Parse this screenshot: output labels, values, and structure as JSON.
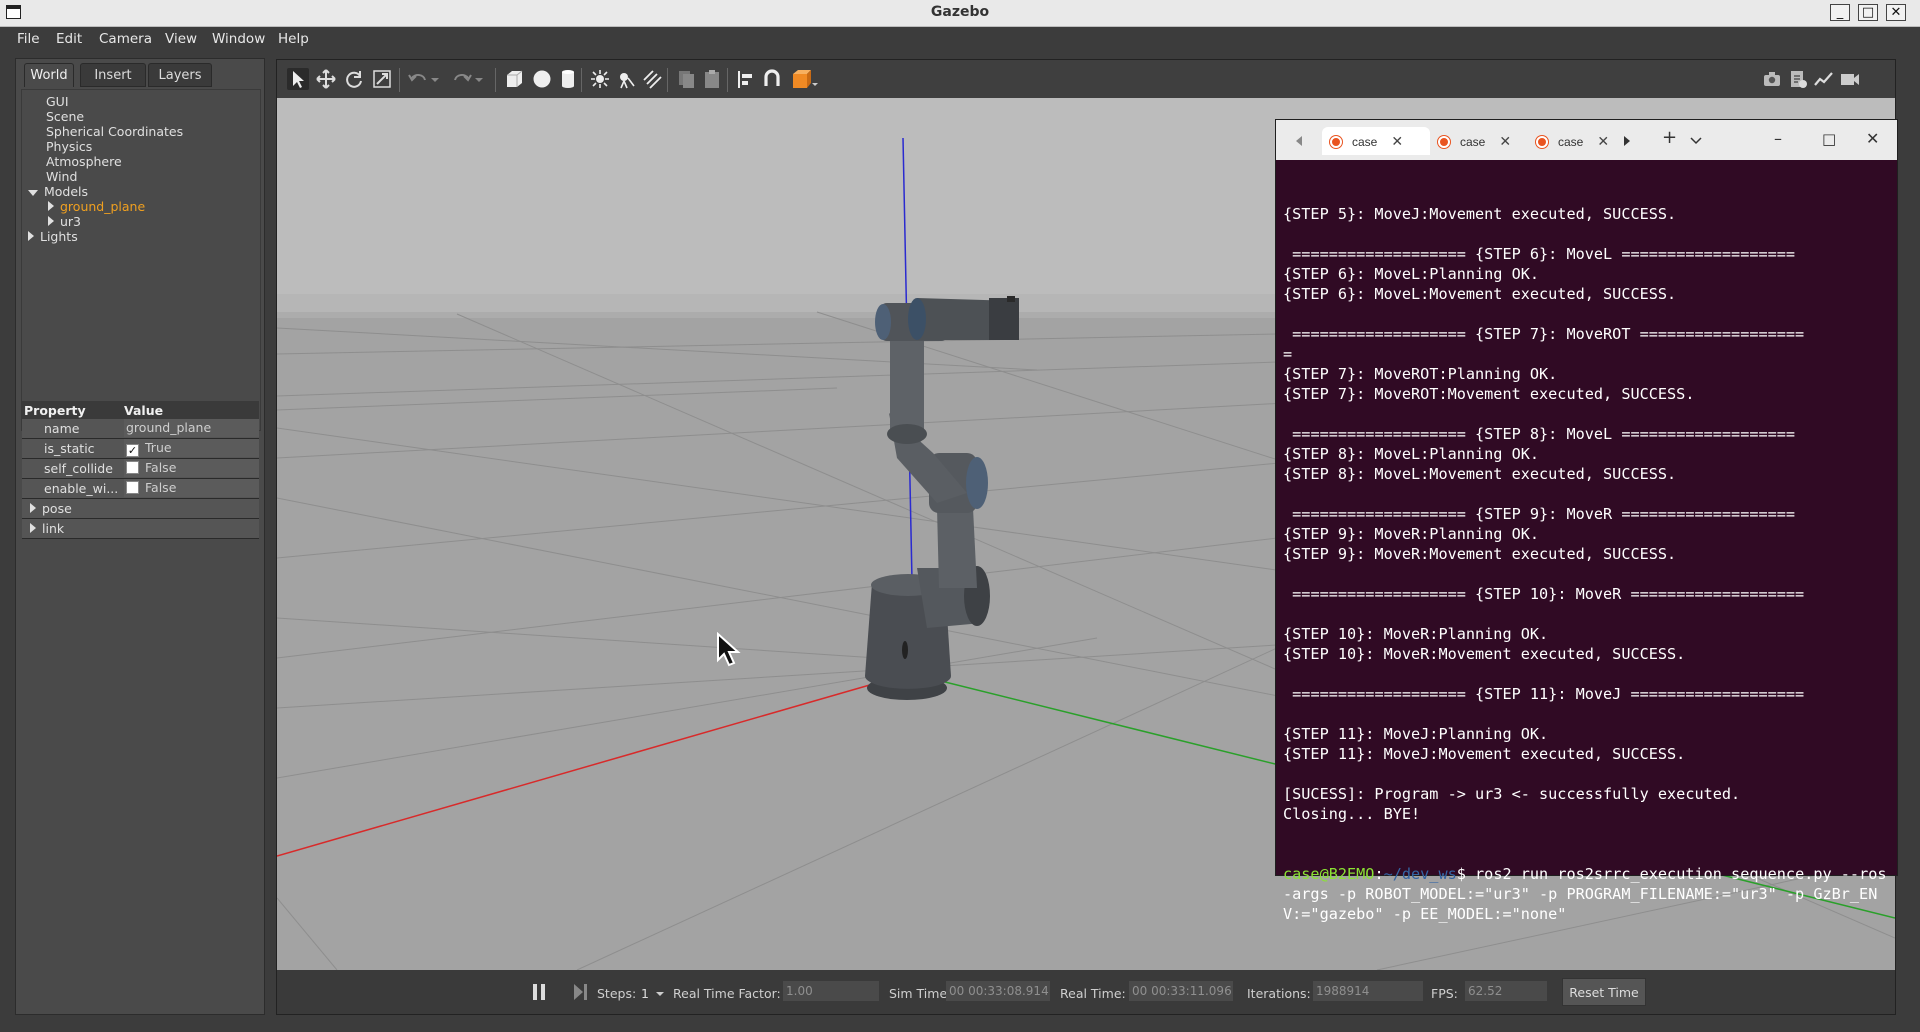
{
  "window": {
    "title": "Gazebo"
  },
  "menu": [
    "File",
    "Edit",
    "Camera",
    "View",
    "Window",
    "Help"
  ],
  "left_tabs": [
    "World",
    "Insert",
    "Layers"
  ],
  "tree": {
    "items": [
      "GUI",
      "Scene",
      "Spherical Coordinates",
      "Physics",
      "Atmosphere",
      "Wind"
    ],
    "models_label": "Models",
    "models": [
      "ground_plane",
      "ur3"
    ],
    "lights_label": "Lights"
  },
  "properties": {
    "header_property": "Property",
    "header_value": "Value",
    "rows": [
      {
        "key": "name",
        "value": "ground_plane"
      },
      {
        "key": "is_static",
        "value": "True",
        "checked": true
      },
      {
        "key": "self_collide",
        "value": "False",
        "checked": false
      },
      {
        "key": "enable_wi...",
        "value": "False",
        "checked": false
      }
    ],
    "expand_rows": [
      "pose",
      "link"
    ]
  },
  "bottom": {
    "steps_label": "Steps:",
    "steps_value": "1",
    "rtf_label": "Real Time Factor:",
    "rtf_value": "1.00",
    "sim_label": "Sim Time:",
    "sim_value": "00 00:33:08.914",
    "real_label": "Real Time:",
    "real_value": "00 00:33:11.096",
    "iter_label": "Iterations:",
    "iter_value": "1988914",
    "fps_label": "FPS:",
    "fps_value": "62.52",
    "reset_label": "Reset Time"
  },
  "terminal": {
    "tabs": [
      "case",
      "case",
      "case"
    ],
    "lines": [
      "{STEP 5}: MoveJ:Movement executed, SUCCESS.",
      "",
      " =================== {STEP 6}: MoveL ===================",
      "{STEP 6}: MoveL:Planning OK.",
      "{STEP 6}: MoveL:Movement executed, SUCCESS.",
      "",
      " =================== {STEP 7}: MoveROT ==================",
      "=",
      "{STEP 7}: MoveROT:Planning OK.",
      "{STEP 7}: MoveROT:Movement executed, SUCCESS.",
      "",
      " =================== {STEP 8}: MoveL ===================",
      "{STEP 8}: MoveL:Planning OK.",
      "{STEP 8}: MoveL:Movement executed, SUCCESS.",
      "",
      " =================== {STEP 9}: MoveR ===================",
      "{STEP 9}: MoveR:Planning OK.",
      "{STEP 9}: MoveR:Movement executed, SUCCESS.",
      "",
      " =================== {STEP 10}: MoveR ===================",
      "",
      "{STEP 10}: MoveR:Planning OK.",
      "{STEP 10}: MoveR:Movement executed, SUCCESS.",
      "",
      " =================== {STEP 11}: MoveJ ===================",
      "",
      "{STEP 11}: MoveJ:Planning OK.",
      "{STEP 11}: MoveJ:Movement executed, SUCCESS.",
      "",
      "[SUCESS]: Program -> ur3 <- successfully executed.",
      "Closing... BYE!"
    ],
    "prompt_user": "case@B2EMO",
    "prompt_path": "~/dev_ws",
    "command": "$ ros2 run ros2srrc_execution sequence.py --ros-args -p ROBOT_MODEL:=\"ur3\" -p PROGRAM_FILENAME:=\"ur3\" -p GzBr_ENV:=\"gazebo\" -p EE_MODEL:=\"none\""
  }
}
